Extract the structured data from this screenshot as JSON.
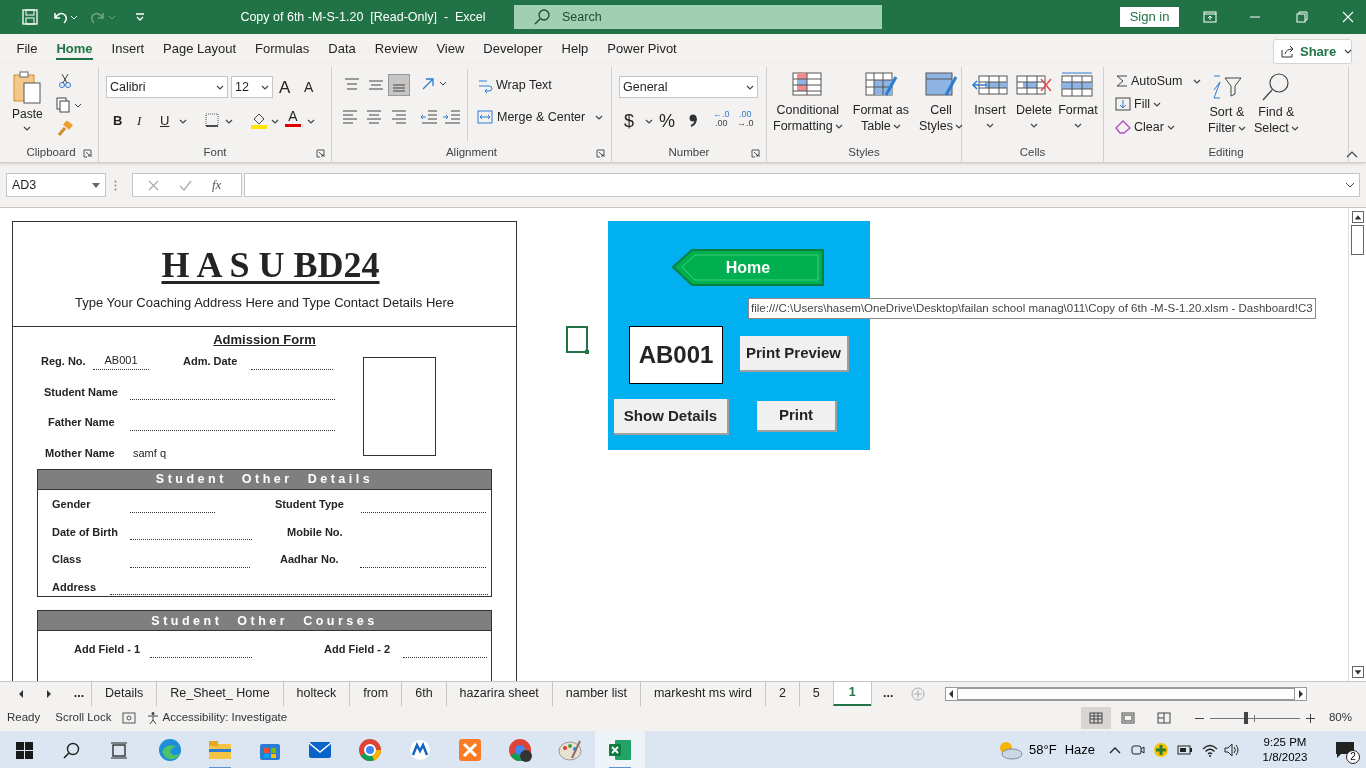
{
  "title_bar": {
    "title": "Copy of 6th -M-S-1.20  [Read-Only]  -  Excel",
    "search": {
      "placeholder": "Search"
    },
    "sign_in": "Sign in"
  },
  "ribbon_tabs": [
    {
      "label": "File",
      "selected": false
    },
    {
      "label": "Home",
      "selected": true
    },
    {
      "label": "Insert",
      "selected": false
    },
    {
      "label": "Page Layout",
      "selected": false
    },
    {
      "label": "Formulas",
      "selected": false
    },
    {
      "label": "Data",
      "selected": false
    },
    {
      "label": "Review",
      "selected": false
    },
    {
      "label": "View",
      "selected": false
    },
    {
      "label": "Developer",
      "selected": false
    },
    {
      "label": "Help",
      "selected": false
    },
    {
      "label": "Power Pivot",
      "selected": false
    }
  ],
  "share": "Share",
  "clipboard": {
    "name": "Clipboard",
    "paste": "Paste"
  },
  "font": {
    "name": "Font",
    "font_name": "Calibri",
    "font_size": "12",
    "grow": "A",
    "shrink": "A",
    "bold": "B",
    "italic": "I",
    "underline": "U",
    "font_color": "A"
  },
  "alignment": {
    "name": "Alignment",
    "wrap_text": "Wrap Text",
    "merge": "Merge & Center"
  },
  "number": {
    "name": "Number",
    "format": "General",
    "currency": "$",
    "percent": "%",
    "decimals": [
      {
        "top": "←.0",
        "bottom": ".00"
      },
      {
        "top": ".00",
        "bottom": "→.0"
      }
    ]
  },
  "styles": {
    "name": "Styles",
    "buttons": [
      {
        "label": "Conditional",
        "label2": "Formatting"
      },
      {
        "label": "Format as",
        "label2": "Table"
      },
      {
        "label": "Cell",
        "label2": "Styles"
      }
    ]
  },
  "cells": {
    "name": "Cells",
    "buttons": [
      "Insert",
      "Delete",
      "Format"
    ]
  },
  "editing": {
    "name": "Editing",
    "autosum": "AutoSum",
    "fill": "Fill",
    "clear": "Clear",
    "sort": {
      "label": "Sort &",
      "label2": "Filter"
    },
    "find": {
      "label": "Find &",
      "label2": "Select"
    }
  },
  "formula_bar": {
    "name_box": "AD3",
    "function_label": "fx"
  },
  "form": {
    "title": "H A S U BD24",
    "subtitle": "Type Your Coaching Address Here and Type Contact Details Here",
    "heading": "Admission Form",
    "fields": [
      {
        "label": "Reg. No.",
        "value": "AB001",
        "blank_line": true
      },
      {
        "label": "Adm. Date",
        "blank_line": true
      },
      {
        "label": "Student Name",
        "blank_line": true
      },
      {
        "label": "Father Name",
        "blank_line": true
      },
      {
        "label": "Mother Name",
        "value": "samf q",
        "blank_line": false
      }
    ],
    "sections": [
      {
        "title": "Student Other Details",
        "fields": [
          {
            "label": "Gender",
            "blank_line": true
          },
          {
            "label": "Student Type",
            "blank_line": true
          },
          {
            "label": "Date of Birth",
            "blank_line": true
          },
          {
            "label": "Mobile No.",
            "blank_line": false
          },
          {
            "label": "Class",
            "blank_line": true
          },
          {
            "label": "Aadhar No.",
            "blank_line": true
          },
          {
            "label": "Address",
            "blank_line": true
          }
        ]
      },
      {
        "title": "Student Other Courses",
        "fields": [
          {
            "label": "Add Field - 1",
            "blank_line": true
          },
          {
            "label": "Add Field - 2",
            "blank_line": true
          }
        ]
      }
    ]
  },
  "dashboard": {
    "home": "Home",
    "reg_no": "AB001",
    "print_preview": "Print Preview",
    "show_details": "Show Details",
    "print": "Print"
  },
  "tooltip": "file:///C:\\Users\\hasem\\OneDrive\\Desktop\\failan school manag\\011\\Copy of 6th -M-S-1.20.xlsm - Dashboard!C3",
  "sheet_tabs": {
    "more_left": "...",
    "more_right": "...",
    "tabs": [
      {
        "label": "Details",
        "selected": false
      },
      {
        "label": "Re_Sheet_ Home",
        "selected": false
      },
      {
        "label": "holteck",
        "selected": false
      },
      {
        "label": "from",
        "selected": false
      },
      {
        "label": "6th",
        "selected": false
      },
      {
        "label": "hazarira sheet",
        "selected": false
      },
      {
        "label": "namber list",
        "selected": false
      },
      {
        "label": "markesht ms wird",
        "selected": false
      },
      {
        "label": "2",
        "selected": false
      },
      {
        "label": "5",
        "selected": false
      },
      {
        "label": "1",
        "selected": true
      }
    ]
  },
  "status_bar": {
    "mode": "Ready",
    "scroll_lock": "Scroll Lock",
    "accessibility": "Accessibility: Investigate",
    "zoom": {
      "label": "80%",
      "level": 0.4
    }
  },
  "taskbar": {
    "temperature": "58°F",
    "weather": "Haze",
    "time": "9:25 PM",
    "date": "1/8/2023",
    "notifications": "2"
  }
}
